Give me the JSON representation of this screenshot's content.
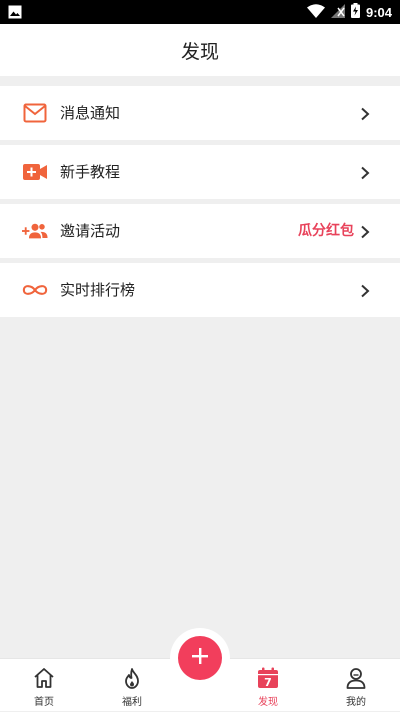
{
  "status_bar": {
    "time": "9:04",
    "icons": [
      "image-icon",
      "wifi-icon",
      "signal-icon",
      "battery-icon"
    ]
  },
  "header": {
    "title": "发现"
  },
  "menu": [
    {
      "label": "消息通知",
      "icon": "mail-icon"
    },
    {
      "label": "新手教程",
      "icon": "video-add-icon"
    },
    {
      "label": "邀请活动",
      "icon": "add-users-icon",
      "badge": "瓜分红包"
    },
    {
      "label": "实时排行榜",
      "icon": "infinity-icon"
    }
  ],
  "tabbar": {
    "items": [
      {
        "label": "首页",
        "icon": "home-icon"
      },
      {
        "label": "福利",
        "icon": "flame-icon"
      },
      {
        "label": "发现",
        "icon": "calendar-icon",
        "icon_text": "7",
        "active": true
      },
      {
        "label": "我的",
        "icon": "profile-icon"
      }
    ],
    "fab_icon": "plus-icon"
  },
  "colors": {
    "accent_orange": "#f0643c",
    "accent_red": "#e8425a",
    "fab": "#f23e5c",
    "background": "#efefef"
  }
}
